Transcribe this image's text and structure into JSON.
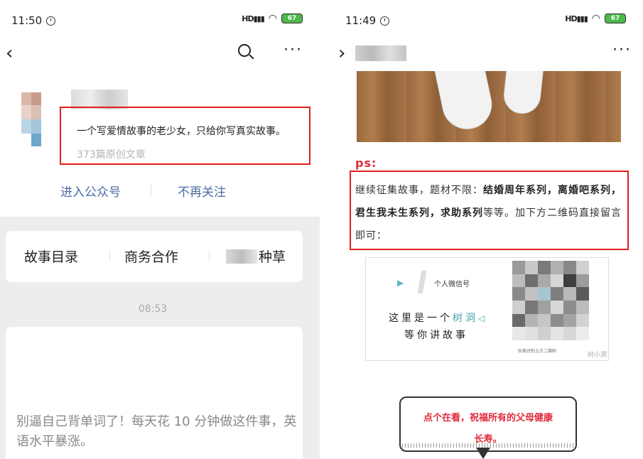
{
  "left": {
    "status": {
      "time": "11:50",
      "signal": "HD",
      "battery": "67"
    },
    "nav": {
      "back": "‹",
      "more": "···"
    },
    "profile": {
      "description": "一个写爱情故事的老少女，只给你写真实故事。",
      "article_count": "373篇原创文章"
    },
    "actions": {
      "enter": "进入公众号",
      "unfollow": "不再关注"
    },
    "menu": {
      "item1": "故事目录",
      "item2": "商务合作",
      "item3": "种草"
    },
    "message_time": "08:53",
    "article": {
      "title": "别逼自己背单词了！每天花 10 分钟做这件事，英语水平暴涨。"
    }
  },
  "right": {
    "status": {
      "time": "11:49",
      "signal": "HD",
      "battery": "67"
    },
    "nav": {
      "back": "›",
      "more": "···"
    },
    "ps_label": "ps:",
    "paragraph": {
      "p1": "继续征集故事，题材不限：",
      "b1": "结婚周年系列，离婚吧系列，君生我未生系列，求助系列",
      "p2": "等等。加下方二维码直接留言即可："
    },
    "qr": {
      "subtitle": "个人微信号",
      "line1a": "这里是一个",
      "line1b": "树洞",
      "line2": "等你讲故事",
      "footer": "长按识别上方二维码",
      "brand": "树小洞"
    },
    "bubble": {
      "line1": "点个在看，祝福所有的父母健康",
      "line2": "长寿。"
    }
  }
}
